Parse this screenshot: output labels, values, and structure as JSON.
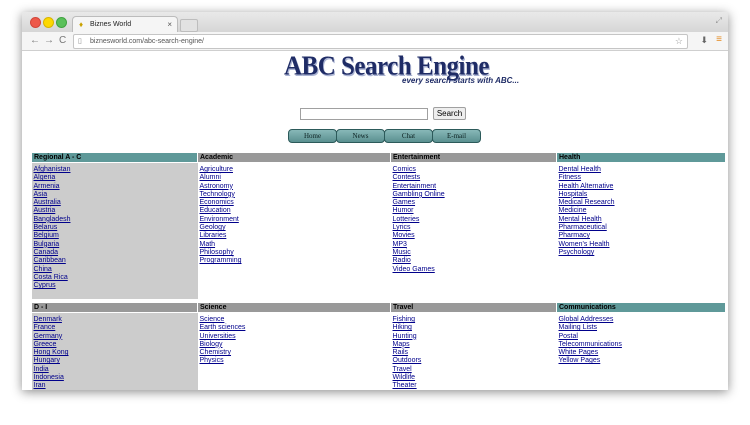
{
  "browser": {
    "tab_title": "Biznes World",
    "url": "biznesworld.com/abc-search-engine/",
    "tab_close": "×",
    "nav_back": "←",
    "nav_forward": "→",
    "nav_reload": "C",
    "star": "☆",
    "menu": "≡"
  },
  "page": {
    "logo_text": "ABC Search Engine",
    "tagline": "every search starts with ABC...",
    "search_placeholder": "",
    "search_button": "Search",
    "nav_buttons": [
      "Home",
      "News",
      "Chat",
      "E-mail"
    ]
  },
  "directory": {
    "sections": [
      {
        "columns": [
          {
            "header": "Regional A - C",
            "links": [
              "Afghanistan",
              "Algeria",
              "Armenia",
              "Asia",
              "Australia",
              "Austria",
              "Bangladesh",
              "Belarus",
              "Belgium",
              "Bulgaria",
              "Canada",
              "Caribbean",
              "China",
              "Costa Rica",
              "Cyprus"
            ]
          },
          {
            "header": "Academic",
            "links": [
              "Agriculture",
              "Alumni",
              "Astronomy",
              "Technology",
              "Economics",
              "Education",
              "Environment",
              "Geology",
              "Libraries",
              "Math",
              "Philosophy",
              "Programming"
            ]
          },
          {
            "header": "Entertainment",
            "links": [
              "Comics",
              "Contests",
              "Entertainment",
              "Gambling Online",
              "Games",
              "Humor",
              "Lotteries",
              "Lyrics",
              "Movies",
              "MP3",
              "Music",
              "Radio",
              "Video Games"
            ]
          },
          {
            "header": "Health",
            "links": [
              "Dental Health",
              "Fitness",
              "Health Alternative",
              "Hospitals",
              "Medical Research",
              "Medicine",
              "Mental Health",
              "Pharmaceutical",
              "Pharmacy",
              "Women's Health",
              "Psychology"
            ]
          }
        ]
      },
      {
        "columns": [
          {
            "header": "D - I",
            "links": [
              "Denmark",
              "France",
              "Germany",
              "Greece",
              "Hong Kong",
              "Hungary",
              "India",
              "Indonesia",
              "Iran"
            ]
          },
          {
            "header": "Science",
            "links": [
              "Science",
              "Earth sciences",
              "Universities",
              "Biology",
              "Chemistry",
              "Physics"
            ]
          },
          {
            "header": "Travel",
            "links": [
              "Fishing",
              "Hiking",
              "Hunting",
              "Maps",
              "Rails",
              "Outdoors",
              "Travel",
              "Wildlife",
              "Theater"
            ]
          },
          {
            "header": "Communications",
            "links": [
              "Global Addresses",
              "Mailing Lists",
              "Postal",
              "Telecommunications",
              "White Pages",
              "Yellow Pages"
            ]
          }
        ]
      }
    ]
  },
  "colors": {
    "header_teal": "#5f9999",
    "header_gray": "#999999",
    "regional_shade": "#cccccc",
    "link": "#00008b",
    "logo": "#1f2c66"
  }
}
